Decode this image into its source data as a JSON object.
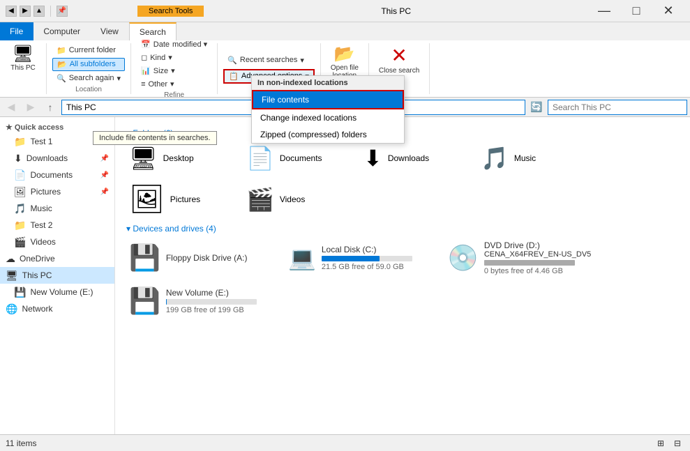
{
  "titlebar": {
    "title": "This PC",
    "search_tools_label": "Search Tools",
    "min": "—",
    "max": "□",
    "close": "✕"
  },
  "ribbon": {
    "tabs": [
      "File",
      "Computer",
      "View",
      "Search"
    ],
    "search_tools_tab": "Search Tools",
    "search_tab": "Search",
    "this_pc_icon": "🖥",
    "this_pc_label": "This PC",
    "date_modified_label": "Date\nmodified",
    "kind_label": "Kind",
    "size_label": "Size",
    "other_label": "Other",
    "recent_searches_label": "Recent searches",
    "advanced_options_label": "Advanced options",
    "change_indexed_label": "Change indexed locations",
    "open_file_location_label": "Open file\nlocation",
    "close_search_label": "Close\nsearch",
    "search_again_label": "Search again",
    "refine_label": "Refine",
    "location_label": "Location"
  },
  "advanced_dropdown": {
    "section_label": "In non-indexed locations",
    "file_contents_label": "File contents",
    "change_indexed_label": "Change indexed locations",
    "zipped_label": "Zipped (compressed) folders"
  },
  "tooltip": {
    "text": "Include file contents in searches."
  },
  "address_bar": {
    "path": "This PC",
    "search_placeholder": "Search This PC"
  },
  "sidebar": {
    "quick_access_label": "Quick access",
    "items": [
      {
        "label": "Test 1",
        "icon": "📁",
        "pinned": true
      },
      {
        "label": "Downloads",
        "icon": "⬇",
        "pinned": true
      },
      {
        "label": "Documents",
        "icon": "📄",
        "pinned": true
      },
      {
        "label": "Pictures",
        "icon": "🖼",
        "pinned": true
      },
      {
        "label": "Music",
        "icon": "🎵"
      },
      {
        "label": "Test 2",
        "icon": "📁"
      },
      {
        "label": "Videos",
        "icon": "🎬"
      },
      {
        "label": "OneDrive",
        "icon": "☁"
      },
      {
        "label": "This PC",
        "icon": "🖥",
        "selected": true
      },
      {
        "label": "New Volume (E:)",
        "icon": "💾"
      },
      {
        "label": "Network",
        "icon": "🌐"
      }
    ]
  },
  "content": {
    "folders_section": "▾  Folders (6)",
    "folders": [
      {
        "name": "Desktop",
        "icon": "🖥"
      },
      {
        "name": "Documents",
        "icon": "📄"
      },
      {
        "name": "Downloads",
        "icon": "⬇"
      },
      {
        "name": "Music",
        "icon": "🎵"
      },
      {
        "name": "Pictures",
        "icon": "🖼"
      },
      {
        "name": "Videos",
        "icon": "🎬"
      }
    ],
    "drives_section": "▾  Devices and drives (4)",
    "drives": [
      {
        "name": "Floppy Disk Drive (A:)",
        "icon": "💾",
        "bar": 0,
        "free": ""
      },
      {
        "name": "Local Disk (C:)",
        "icon": "💻",
        "bar": 64,
        "free": "21.5 GB free of 59.0 GB"
      },
      {
        "name": "DVD Drive (D:)\nCENA_X64FREV_EN-US_DV5",
        "icon": "💿",
        "bar": 0,
        "free": "0 bytes free of 4.46 GB"
      },
      {
        "name": "New Volume (E:)",
        "icon": "💾",
        "bar": 1,
        "free": "199 GB free of 199 GB"
      }
    ]
  },
  "status_bar": {
    "items_label": "11 items"
  }
}
